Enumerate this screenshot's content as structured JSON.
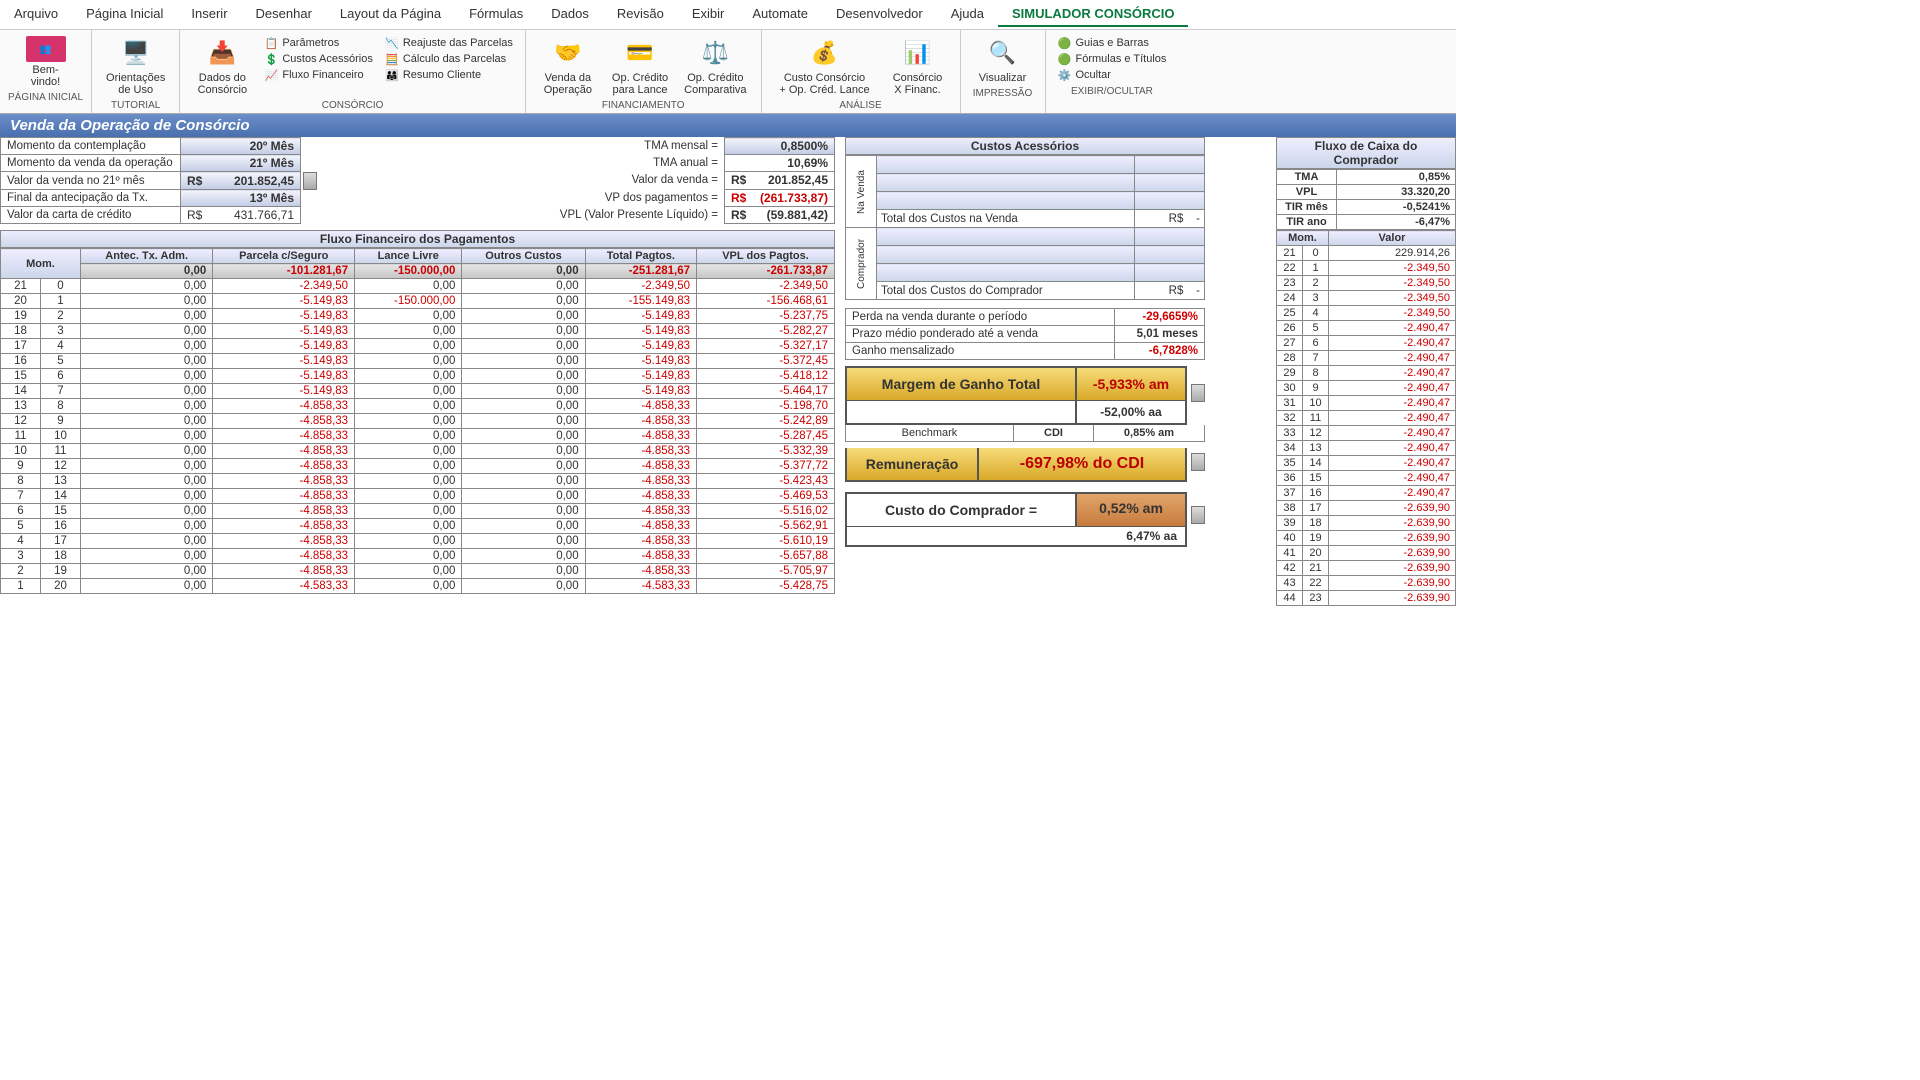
{
  "menu": [
    "Arquivo",
    "Página Inicial",
    "Inserir",
    "Desenhar",
    "Layout da Página",
    "Fórmulas",
    "Dados",
    "Revisão",
    "Exibir",
    "Automate",
    "Desenvolvedor",
    "Ajuda",
    "SIMULADOR CONSÓRCIO"
  ],
  "ribbon": {
    "g1": {
      "label": "PÁGINA INICIAL",
      "btn": {
        "label": "Bem-\nvindo!"
      }
    },
    "g2": {
      "label": "TUTORIAL",
      "btn": {
        "label": "Orientações\nde Uso"
      }
    },
    "g3": {
      "label": "CONSÓRCIO",
      "btn": {
        "label": "Dados do\nConsórcio"
      },
      "c1": [
        "Parâmetros",
        "Custos Acessórios",
        "Fluxo Financeiro"
      ],
      "c2": [
        "Reajuste das Parcelas",
        "Cálculo das Parcelas",
        "Resumo Cliente"
      ]
    },
    "g4": {
      "label": "FINANCIAMENTO",
      "b1": "Venda da\nOperação",
      "b2": "Op. Crédito\npara Lance",
      "b3": "Op. Crédito\nComparativa"
    },
    "g5": {
      "label": "ANÁLISE",
      "b1": "Custo Consórcio\n+ Op. Créd. Lance",
      "b2": "Consórcio\nX Financ."
    },
    "g6": {
      "label": "IMPRESSÃO",
      "b": "Visualizar"
    },
    "g7": {
      "label": "EXIBIR/OCULTAR",
      "items": [
        "Guias e Barras",
        "Fórmulas e Títulos",
        "Ocultar"
      ]
    }
  },
  "title": "Venda da Operação de Consórcio",
  "p1": [
    {
      "l": "Momento da contemplação",
      "v": "20º Mês",
      "hl": true
    },
    {
      "l": "Momento da venda da operação",
      "v": "21º Mês",
      "hl": true
    },
    {
      "l": "Valor da venda no 21º mês",
      "p": "R$",
      "v": "201.852,45",
      "hl": true,
      "slider": true
    },
    {
      "l": "Final da antecipação da Tx.",
      "v": "13º Mês",
      "hl": true
    },
    {
      "l": "Valor da carta de crédito",
      "p": "R$",
      "v": "431.766,71",
      "hl": false
    }
  ],
  "p2": [
    {
      "l": "TMA mensal =",
      "v": "0,8500%",
      "hl": true
    },
    {
      "l": "TMA anual =",
      "v": "10,69%",
      "b": true
    },
    {
      "l": "Valor da venda =",
      "p": "R$",
      "v": "201.852,45",
      "b": true
    },
    {
      "l": "VP dos pagamentos =",
      "p": "R$",
      "v": "(261.733,87)",
      "b": true,
      "neg": true
    },
    {
      "l": "VPL (Valor Presente Líquido) =",
      "p": "R$",
      "v": "(59.881,42)",
      "b": true
    }
  ],
  "fluxo": {
    "title": "Fluxo Financeiro dos Pagamentos",
    "hdr": [
      "Mom.",
      "Antec. Tx. Adm.",
      "Parcela c/Seguro",
      "Lance Livre",
      "Outros Custos",
      "Total Pagtos.",
      "VPL dos Pagtos."
    ],
    "totals": [
      "0,00",
      "-101.281,67",
      "-150.000,00",
      "0,00",
      "-251.281,67",
      "-261.733,87"
    ],
    "rows": [
      {
        "m1": "21",
        "m2": "0",
        "a": "0,00",
        "p": "-2.349,50",
        "l": "0,00",
        "o": "0,00",
        "t": "-2.349,50",
        "v": "-2.349,50"
      },
      {
        "m1": "20",
        "m2": "1",
        "a": "0,00",
        "p": "-5.149,83",
        "l": "-150.000,00",
        "o": "0,00",
        "t": "-155.149,83",
        "v": "-156.468,61"
      },
      {
        "m1": "19",
        "m2": "2",
        "a": "0,00",
        "p": "-5.149,83",
        "l": "0,00",
        "o": "0,00",
        "t": "-5.149,83",
        "v": "-5.237,75"
      },
      {
        "m1": "18",
        "m2": "3",
        "a": "0,00",
        "p": "-5.149,83",
        "l": "0,00",
        "o": "0,00",
        "t": "-5.149,83",
        "v": "-5.282,27"
      },
      {
        "m1": "17",
        "m2": "4",
        "a": "0,00",
        "p": "-5.149,83",
        "l": "0,00",
        "o": "0,00",
        "t": "-5.149,83",
        "v": "-5.327,17"
      },
      {
        "m1": "16",
        "m2": "5",
        "a": "0,00",
        "p": "-5.149,83",
        "l": "0,00",
        "o": "0,00",
        "t": "-5.149,83",
        "v": "-5.372,45"
      },
      {
        "m1": "15",
        "m2": "6",
        "a": "0,00",
        "p": "-5.149,83",
        "l": "0,00",
        "o": "0,00",
        "t": "-5.149,83",
        "v": "-5.418,12"
      },
      {
        "m1": "14",
        "m2": "7",
        "a": "0,00",
        "p": "-5.149,83",
        "l": "0,00",
        "o": "0,00",
        "t": "-5.149,83",
        "v": "-5.464,17"
      },
      {
        "m1": "13",
        "m2": "8",
        "a": "0,00",
        "p": "-4.858,33",
        "l": "0,00",
        "o": "0,00",
        "t": "-4.858,33",
        "v": "-5.198,70"
      },
      {
        "m1": "12",
        "m2": "9",
        "a": "0,00",
        "p": "-4.858,33",
        "l": "0,00",
        "o": "0,00",
        "t": "-4.858,33",
        "v": "-5.242,89"
      },
      {
        "m1": "11",
        "m2": "10",
        "a": "0,00",
        "p": "-4.858,33",
        "l": "0,00",
        "o": "0,00",
        "t": "-4.858,33",
        "v": "-5.287,45"
      },
      {
        "m1": "10",
        "m2": "11",
        "a": "0,00",
        "p": "-4.858,33",
        "l": "0,00",
        "o": "0,00",
        "t": "-4.858,33",
        "v": "-5.332,39"
      },
      {
        "m1": "9",
        "m2": "12",
        "a": "0,00",
        "p": "-4.858,33",
        "l": "0,00",
        "o": "0,00",
        "t": "-4.858,33",
        "v": "-5.377,72"
      },
      {
        "m1": "8",
        "m2": "13",
        "a": "0,00",
        "p": "-4.858,33",
        "l": "0,00",
        "o": "0,00",
        "t": "-4.858,33",
        "v": "-5.423,43"
      },
      {
        "m1": "7",
        "m2": "14",
        "a": "0,00",
        "p": "-4.858,33",
        "l": "0,00",
        "o": "0,00",
        "t": "-4.858,33",
        "v": "-5.469,53"
      },
      {
        "m1": "6",
        "m2": "15",
        "a": "0,00",
        "p": "-4.858,33",
        "l": "0,00",
        "o": "0,00",
        "t": "-4.858,33",
        "v": "-5.516,02"
      },
      {
        "m1": "5",
        "m2": "16",
        "a": "0,00",
        "p": "-4.858,33",
        "l": "0,00",
        "o": "0,00",
        "t": "-4.858,33",
        "v": "-5.562,91"
      },
      {
        "m1": "4",
        "m2": "17",
        "a": "0,00",
        "p": "-4.858,33",
        "l": "0,00",
        "o": "0,00",
        "t": "-4.858,33",
        "v": "-5.610,19"
      },
      {
        "m1": "3",
        "m2": "18",
        "a": "0,00",
        "p": "-4.858,33",
        "l": "0,00",
        "o": "0,00",
        "t": "-4.858,33",
        "v": "-5.657,88"
      },
      {
        "m1": "2",
        "m2": "19",
        "a": "0,00",
        "p": "-4.858,33",
        "l": "0,00",
        "o": "0,00",
        "t": "-4.858,33",
        "v": "-5.705,97"
      },
      {
        "m1": "1",
        "m2": "20",
        "a": "0,00",
        "p": "-4.583,33",
        "l": "0,00",
        "o": "0,00",
        "t": "-4.583,33",
        "v": "-5.428,75"
      }
    ]
  },
  "cost": {
    "title": "Custos Acessórios",
    "sec1": "Na Venda",
    "sec2": "Comprador",
    "tot1l": "Total dos Custos na Venda",
    "tot1p": "R$",
    "tot1v": "-",
    "tot2l": "Total dos Custos do Comprador",
    "tot2p": "R$",
    "tot2v": "-"
  },
  "kv": [
    {
      "l": "Perda na venda durante o período",
      "v": "-29,6659%",
      "neg": true
    },
    {
      "l": "Prazo médio ponderado até a venda",
      "v": "5,01 meses"
    },
    {
      "l": "Ganho mensalizado",
      "v": "-6,7828%",
      "neg": true
    }
  ],
  "margin": {
    "label": "Margem de Ganho Total",
    "v1": "-5,933% am",
    "v2": "-52,00% aa"
  },
  "bench": {
    "l": "Benchmark",
    "c": "CDI",
    "v": "0,85% am"
  },
  "remun": {
    "label": "Remuneração",
    "v": "-697,98%  do CDI"
  },
  "buyer": {
    "label": "Custo do Comprador =",
    "v1": "0,52% am",
    "v2": "6,47% aa"
  },
  "rbox": {
    "title": "Fluxo de Caixa do\nComprador",
    "rows": [
      {
        "l": "TMA",
        "v": "0,85%"
      },
      {
        "l": "VPL",
        "v": "33.320,20"
      },
      {
        "l": "TIR mês",
        "v": "-0,5241%"
      },
      {
        "l": "TIR ano",
        "v": "-6,47%"
      }
    ],
    "hdr": [
      "Mom.",
      "Valor"
    ],
    "flow": [
      {
        "m1": "21",
        "m2": "0",
        "v": "229.914,26",
        "pos": true
      },
      {
        "m1": "22",
        "m2": "1",
        "v": "-2.349,50"
      },
      {
        "m1": "23",
        "m2": "2",
        "v": "-2.349,50"
      },
      {
        "m1": "24",
        "m2": "3",
        "v": "-2.349,50"
      },
      {
        "m1": "25",
        "m2": "4",
        "v": "-2.349,50"
      },
      {
        "m1": "26",
        "m2": "5",
        "v": "-2.490,47"
      },
      {
        "m1": "27",
        "m2": "6",
        "v": "-2.490,47"
      },
      {
        "m1": "28",
        "m2": "7",
        "v": "-2.490,47"
      },
      {
        "m1": "29",
        "m2": "8",
        "v": "-2.490,47"
      },
      {
        "m1": "30",
        "m2": "9",
        "v": "-2.490,47"
      },
      {
        "m1": "31",
        "m2": "10",
        "v": "-2.490,47"
      },
      {
        "m1": "32",
        "m2": "11",
        "v": "-2.490,47"
      },
      {
        "m1": "33",
        "m2": "12",
        "v": "-2.490,47"
      },
      {
        "m1": "34",
        "m2": "13",
        "v": "-2.490,47"
      },
      {
        "m1": "35",
        "m2": "14",
        "v": "-2.490,47"
      },
      {
        "m1": "36",
        "m2": "15",
        "v": "-2.490,47"
      },
      {
        "m1": "37",
        "m2": "16",
        "v": "-2.490,47"
      },
      {
        "m1": "38",
        "m2": "17",
        "v": "-2.639,90"
      },
      {
        "m1": "39",
        "m2": "18",
        "v": "-2.639,90"
      },
      {
        "m1": "40",
        "m2": "19",
        "v": "-2.639,90"
      },
      {
        "m1": "41",
        "m2": "20",
        "v": "-2.639,90"
      },
      {
        "m1": "42",
        "m2": "21",
        "v": "-2.639,90"
      },
      {
        "m1": "43",
        "m2": "22",
        "v": "-2.639,90"
      },
      {
        "m1": "44",
        "m2": "23",
        "v": "-2.639,90"
      }
    ]
  }
}
